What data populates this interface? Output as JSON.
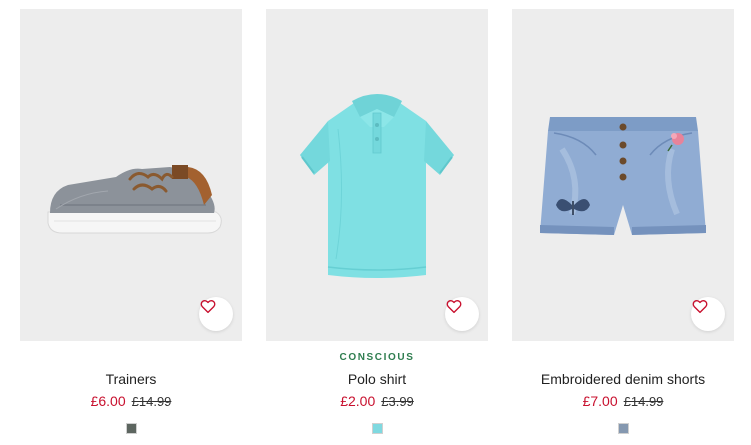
{
  "products": [
    {
      "name": "Trainers",
      "tag": "",
      "price": "£6.00",
      "old_price": "£14.99",
      "swatch_color": "#5d6660",
      "favourite_icon": "heart-outline-icon"
    },
    {
      "name": "Polo shirt",
      "tag": "CONSCIOUS",
      "price": "£2.00",
      "old_price": "£3.99",
      "swatch_color": "#7fd9e0",
      "favourite_icon": "heart-outline-icon"
    },
    {
      "name": "Embroidered denim shorts",
      "tag": "",
      "price": "£7.00",
      "old_price": "£14.99",
      "swatch_color": "#8598b0",
      "favourite_icon": "heart-outline-icon"
    }
  ],
  "colors": {
    "sale_price": "#c8102e",
    "conscious_tag": "#2e7d4f",
    "image_background": "#ededed"
  }
}
